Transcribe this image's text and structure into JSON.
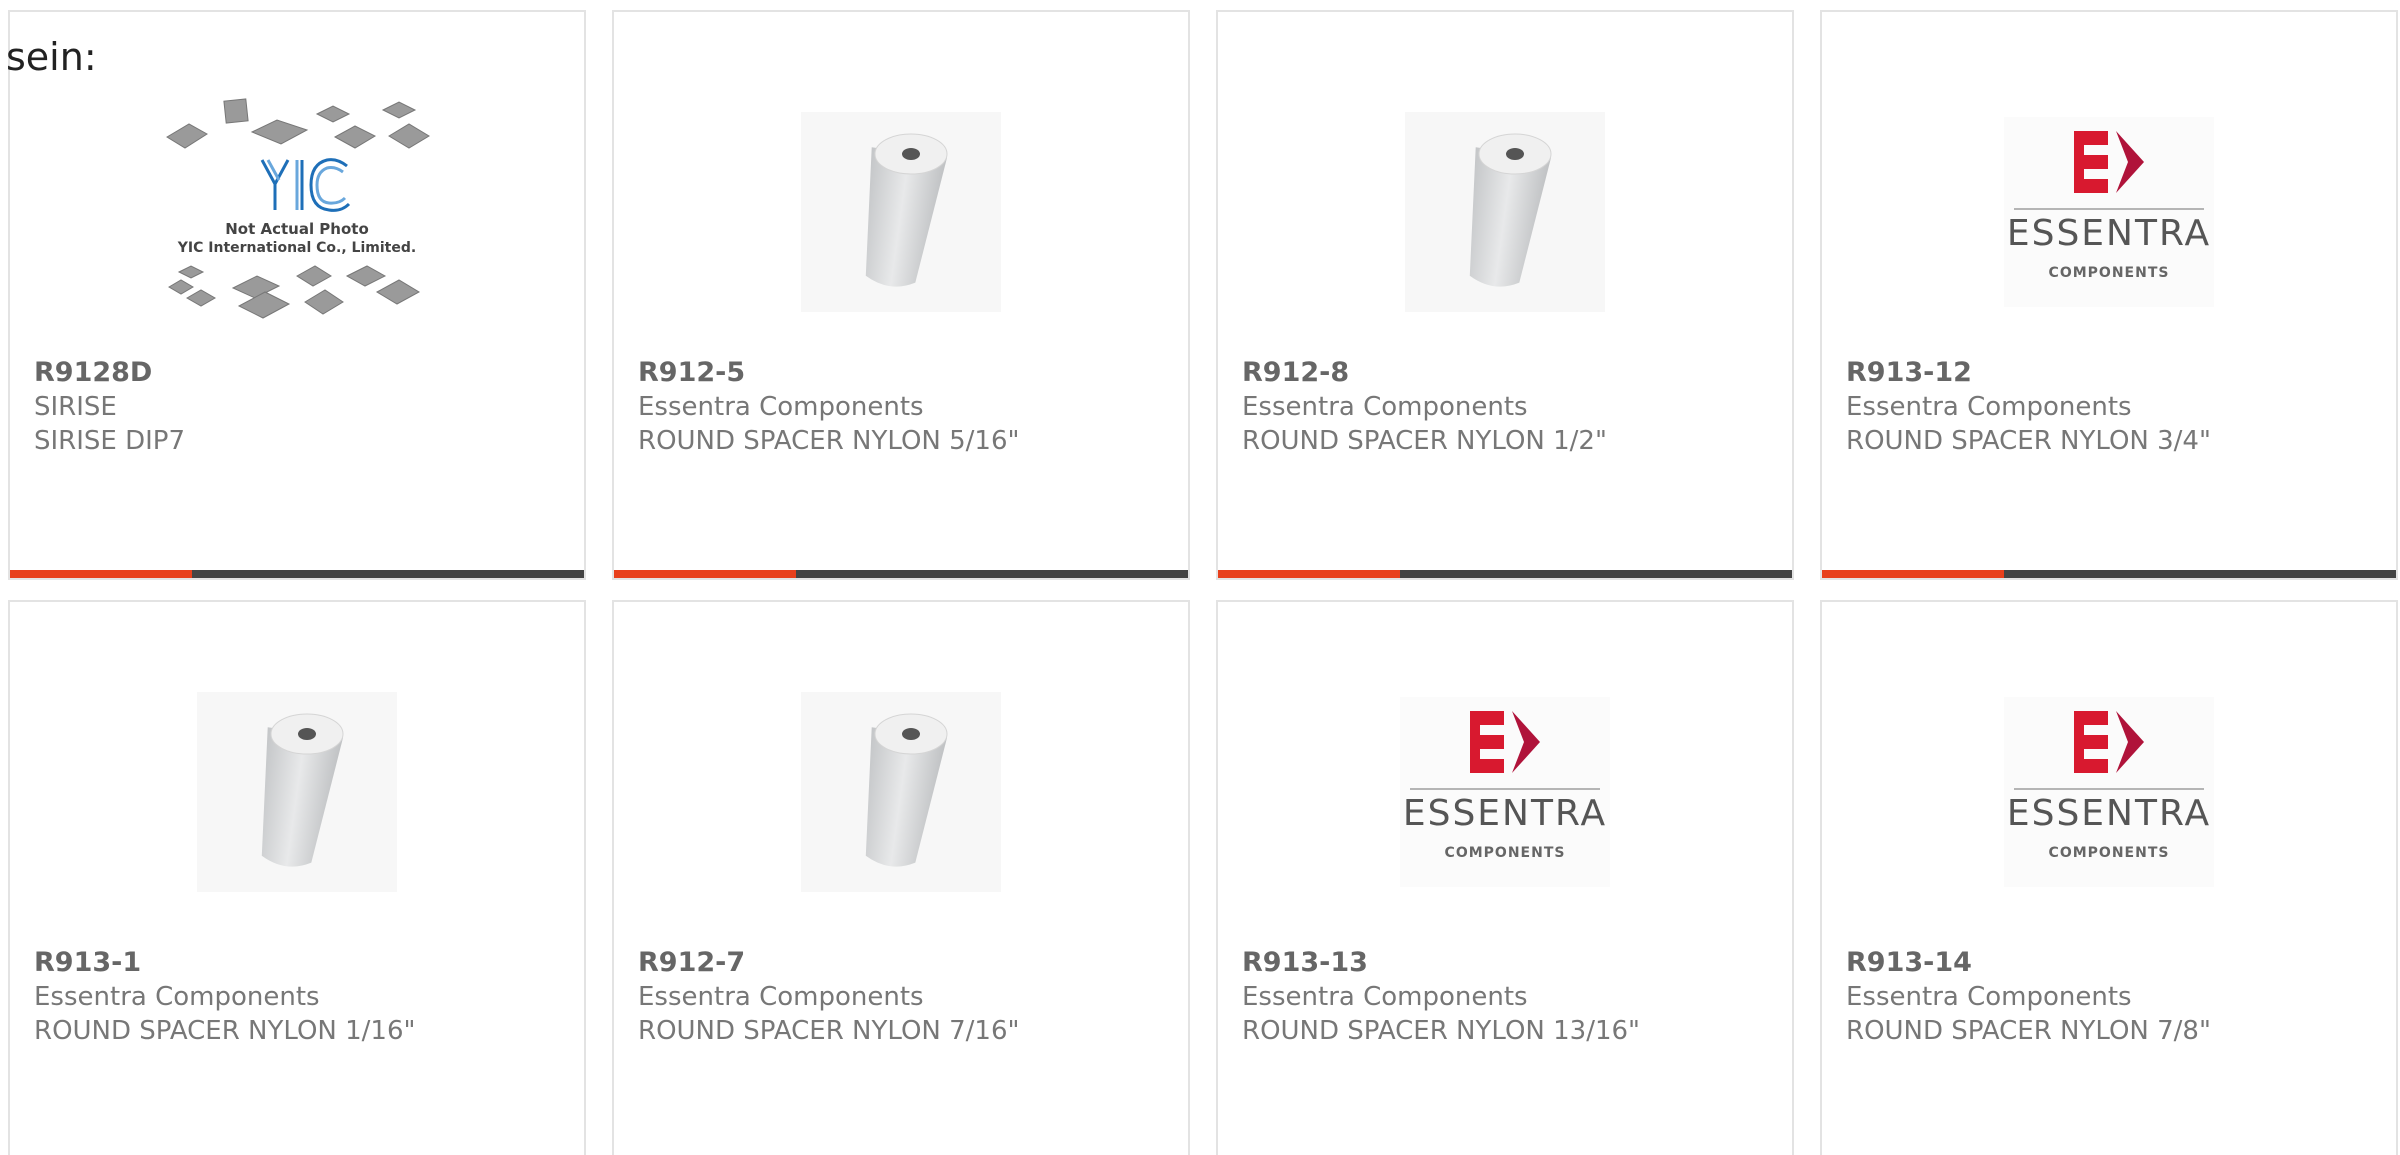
{
  "header": {
    "partial_text": "sein:"
  },
  "products": [
    {
      "part_number": "R9128D",
      "manufacturer": "SIRISE",
      "description": "SIRISE DIP7",
      "image": "placeholder-chips",
      "placeholder_text": [
        "Not Actual Photo",
        "YIC International Co., Limited."
      ],
      "logo_text": "YIC"
    },
    {
      "part_number": "R912-5",
      "manufacturer": "Essentra Components",
      "description": "ROUND SPACER NYLON 5/16\"",
      "image": "spacer-cylinder"
    },
    {
      "part_number": "R912-8",
      "manufacturer": "Essentra Components",
      "description": "ROUND SPACER NYLON 1/2\"",
      "image": "spacer-cylinder"
    },
    {
      "part_number": "R913-12",
      "manufacturer": "Essentra Components",
      "description": "ROUND SPACER NYLON 3/4\"",
      "image": "essentra-logo",
      "logo_word": "ESSENTRA",
      "logo_sub": "COMPONENTS"
    },
    {
      "part_number": "R913-1",
      "manufacturer": "Essentra Components",
      "description": "ROUND SPACER NYLON 1/16\"",
      "image": "spacer-cylinder"
    },
    {
      "part_number": "R912-7",
      "manufacturer": "Essentra Components",
      "description": "ROUND SPACER NYLON 7/16\"",
      "image": "spacer-cylinder"
    },
    {
      "part_number": "R913-13",
      "manufacturer": "Essentra Components",
      "description": "ROUND SPACER NYLON 13/16\"",
      "image": "essentra-logo",
      "logo_word": "ESSENTRA",
      "logo_sub": "COMPONENTS"
    },
    {
      "part_number": "R913-14",
      "manufacturer": "Essentra Components",
      "description": "ROUND SPACER NYLON 7/8\"",
      "image": "essentra-logo",
      "logo_word": "ESSENTRA",
      "logo_sub": "COMPONENTS"
    }
  ],
  "colors": {
    "accent": "#e8401c",
    "bar": "#444444",
    "border": "#e3e3e3",
    "logo_red": "#d8192f",
    "yic_blue": "#1e6fb8"
  }
}
